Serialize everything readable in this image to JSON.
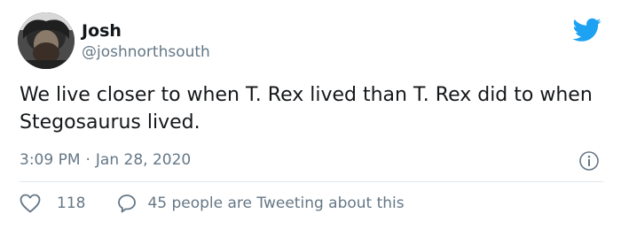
{
  "author": {
    "name": "Josh",
    "handle": "@joshnorthsouth"
  },
  "tweet": {
    "text": "We live closer to when T. Rex lived than T. Rex did to when Stegosaurus lived."
  },
  "meta": {
    "time": "3:09 PM",
    "separator": "·",
    "date": "Jan 28, 2020"
  },
  "actions": {
    "like_count": "118",
    "reply_text": "45 people are Tweeting about this"
  },
  "colors": {
    "brand": "#1DA1F2",
    "secondary_text": "#657786",
    "primary_text": "#14171a",
    "divider": "#e1e8ed"
  },
  "icons": {
    "logo": "twitter-bird-icon",
    "info": "info-icon",
    "like": "heart-icon",
    "reply": "speech-bubble-icon"
  }
}
